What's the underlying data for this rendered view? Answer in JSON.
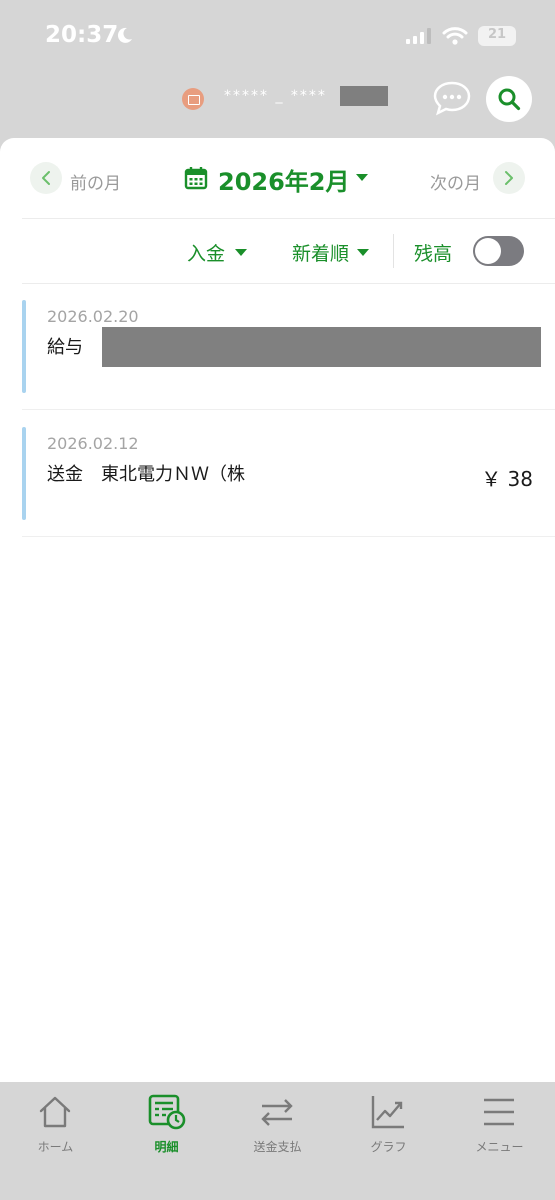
{
  "status_bar": {
    "time": "20:37",
    "battery": "21"
  },
  "header": {
    "account_masked": "***** _ ****"
  },
  "month_nav": {
    "prev_label": "前の月",
    "next_label": "次の月",
    "current": "2026年2月"
  },
  "filters": {
    "type": "入金",
    "sort": "新着順",
    "balance_label": "残高",
    "balance_toggle_on": false
  },
  "transactions": [
    {
      "date": "2026.02.20",
      "description": "給与",
      "amount": ""
    },
    {
      "date": "2026.02.12",
      "description": "送金　東北電力ＮＷ（株",
      "amount": "￥ 38"
    }
  ],
  "bottom_nav": [
    {
      "label": "ホーム",
      "icon": "home-icon",
      "active": false
    },
    {
      "label": "明細",
      "icon": "statement-icon",
      "active": true
    },
    {
      "label": "送金支払",
      "icon": "transfer-icon",
      "active": false
    },
    {
      "label": "グラフ",
      "icon": "chart-icon",
      "active": false
    },
    {
      "label": "メニュー",
      "icon": "menu-icon",
      "active": false
    }
  ],
  "colors": {
    "accent": "#1a8f2a",
    "txn_bar": "#a9d3ef",
    "toggle_off": "#7b7b80"
  }
}
